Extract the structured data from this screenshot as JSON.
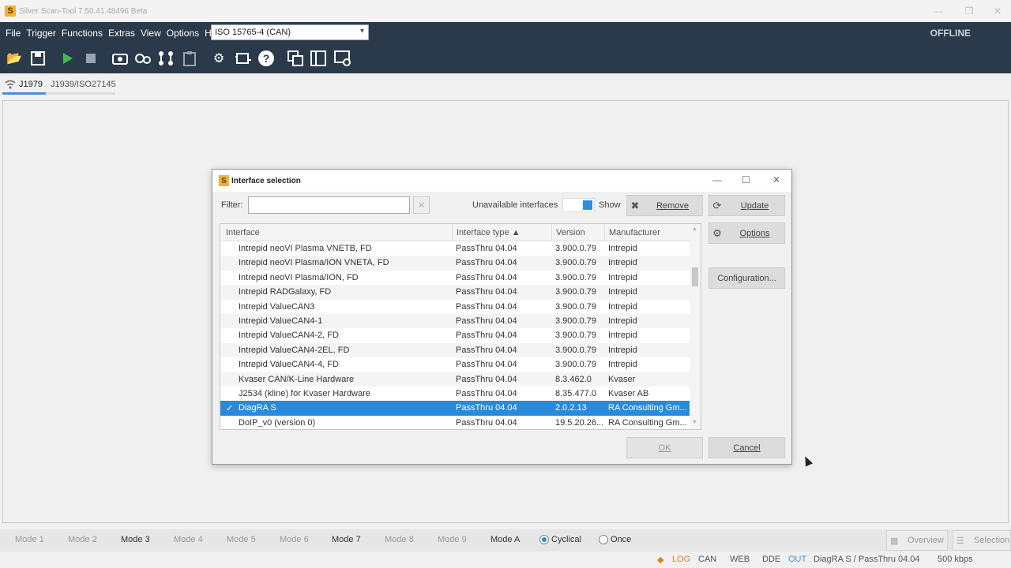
{
  "window": {
    "title": "Silver Scan-Tool 7.50.41.48496 Beta",
    "app_icon_letter": "S"
  },
  "menu": {
    "items": [
      "File",
      "Trigger",
      "Functions",
      "Extras",
      "View",
      "Options",
      "Help"
    ],
    "protocol_selected": "ISO 15765-4 (CAN)",
    "status": "OFFLINE"
  },
  "toolbar": {
    "icons": [
      "open-folder-icon",
      "save-icon",
      "play-icon",
      "stop-icon",
      "camera-icon",
      "record-icon",
      "connections-icon",
      "clipboard-icon",
      "gear-icon",
      "vehicle-icon",
      "help-icon",
      "windows-icon",
      "panel-icon",
      "monitor-icon"
    ]
  },
  "tabs": [
    {
      "label": "J1979",
      "active": true
    },
    {
      "label": "J1939/ISO27145",
      "active": false
    }
  ],
  "dialog": {
    "title": "Interface selection",
    "filter_label": "Filter:",
    "filter_value": "",
    "unavailable_label": "Unavailable interfaces",
    "show_label": "Show",
    "buttons": {
      "remove": "Remove",
      "update": "Update",
      "options": "Options",
      "configuration": "Configuration...",
      "ok": "OK",
      "cancel": "Cancel"
    },
    "columns": [
      "Interface",
      "Interface type ▲",
      "Version",
      "Manufacturer"
    ],
    "rows": [
      [
        "Intrepid neoVI Plasma VNETB, FD",
        "PassThru 04.04",
        "3.900.0.79",
        "Intrepid"
      ],
      [
        "Intrepid neoVI Plasma/ION VNETA, FD",
        "PassThru 04.04",
        "3.900.0.79",
        "Intrepid"
      ],
      [
        "Intrepid neoVI Plasma/ION, FD",
        "PassThru 04.04",
        "3.900.0.79",
        "Intrepid"
      ],
      [
        "Intrepid RADGalaxy, FD",
        "PassThru 04.04",
        "3.900.0.79",
        "Intrepid"
      ],
      [
        "Intrepid ValueCAN3",
        "PassThru 04.04",
        "3.900.0.79",
        "Intrepid"
      ],
      [
        "Intrepid ValueCAN4-1",
        "PassThru 04.04",
        "3.900.0.79",
        "Intrepid"
      ],
      [
        "Intrepid ValueCAN4-2, FD",
        "PassThru 04.04",
        "3.900.0.79",
        "Intrepid"
      ],
      [
        "Intrepid ValueCAN4-2EL, FD",
        "PassThru 04.04",
        "3.900.0.79",
        "Intrepid"
      ],
      [
        "Intrepid ValueCAN4-4, FD",
        "PassThru 04.04",
        "3.900.0.79",
        "Intrepid"
      ],
      [
        "Kvaser CAN/K-Line Hardware",
        "PassThru 04.04",
        "8.3.462.0",
        "Kvaser"
      ],
      [
        "J2534 (kline) for Kvaser Hardware",
        "PassThru 04.04",
        "8.35.477.0",
        "Kvaser AB"
      ],
      [
        "DiagRA S",
        "PassThru 04.04",
        "2.0.2.13",
        "RA Consulting Gm..."
      ],
      [
        "DoIP_v0 (version 0)",
        "PassThru 04.04",
        "19.5.20.26...",
        "RA Consulting Gm..."
      ]
    ],
    "selected_row": 11
  },
  "modebar": {
    "modes": [
      "Mode 1",
      "Mode 2",
      "Mode 3",
      "Mode 4",
      "Mode 5",
      "Mode 6",
      "Mode 7",
      "Mode 8",
      "Mode 9",
      "Mode A"
    ],
    "active_modes": [
      "Mode 3",
      "Mode 7",
      "Mode A"
    ],
    "cyclical": "Cyclical",
    "once": "Once",
    "overview": "Overview",
    "selection": "Selection"
  },
  "statusbar": {
    "log": "LOG",
    "can": "CAN",
    "web": "WEB",
    "dde": "DDE",
    "out": "OUT",
    "interface": "DiagRA S / PassThru 04.04",
    "baud": "500 kbps"
  }
}
